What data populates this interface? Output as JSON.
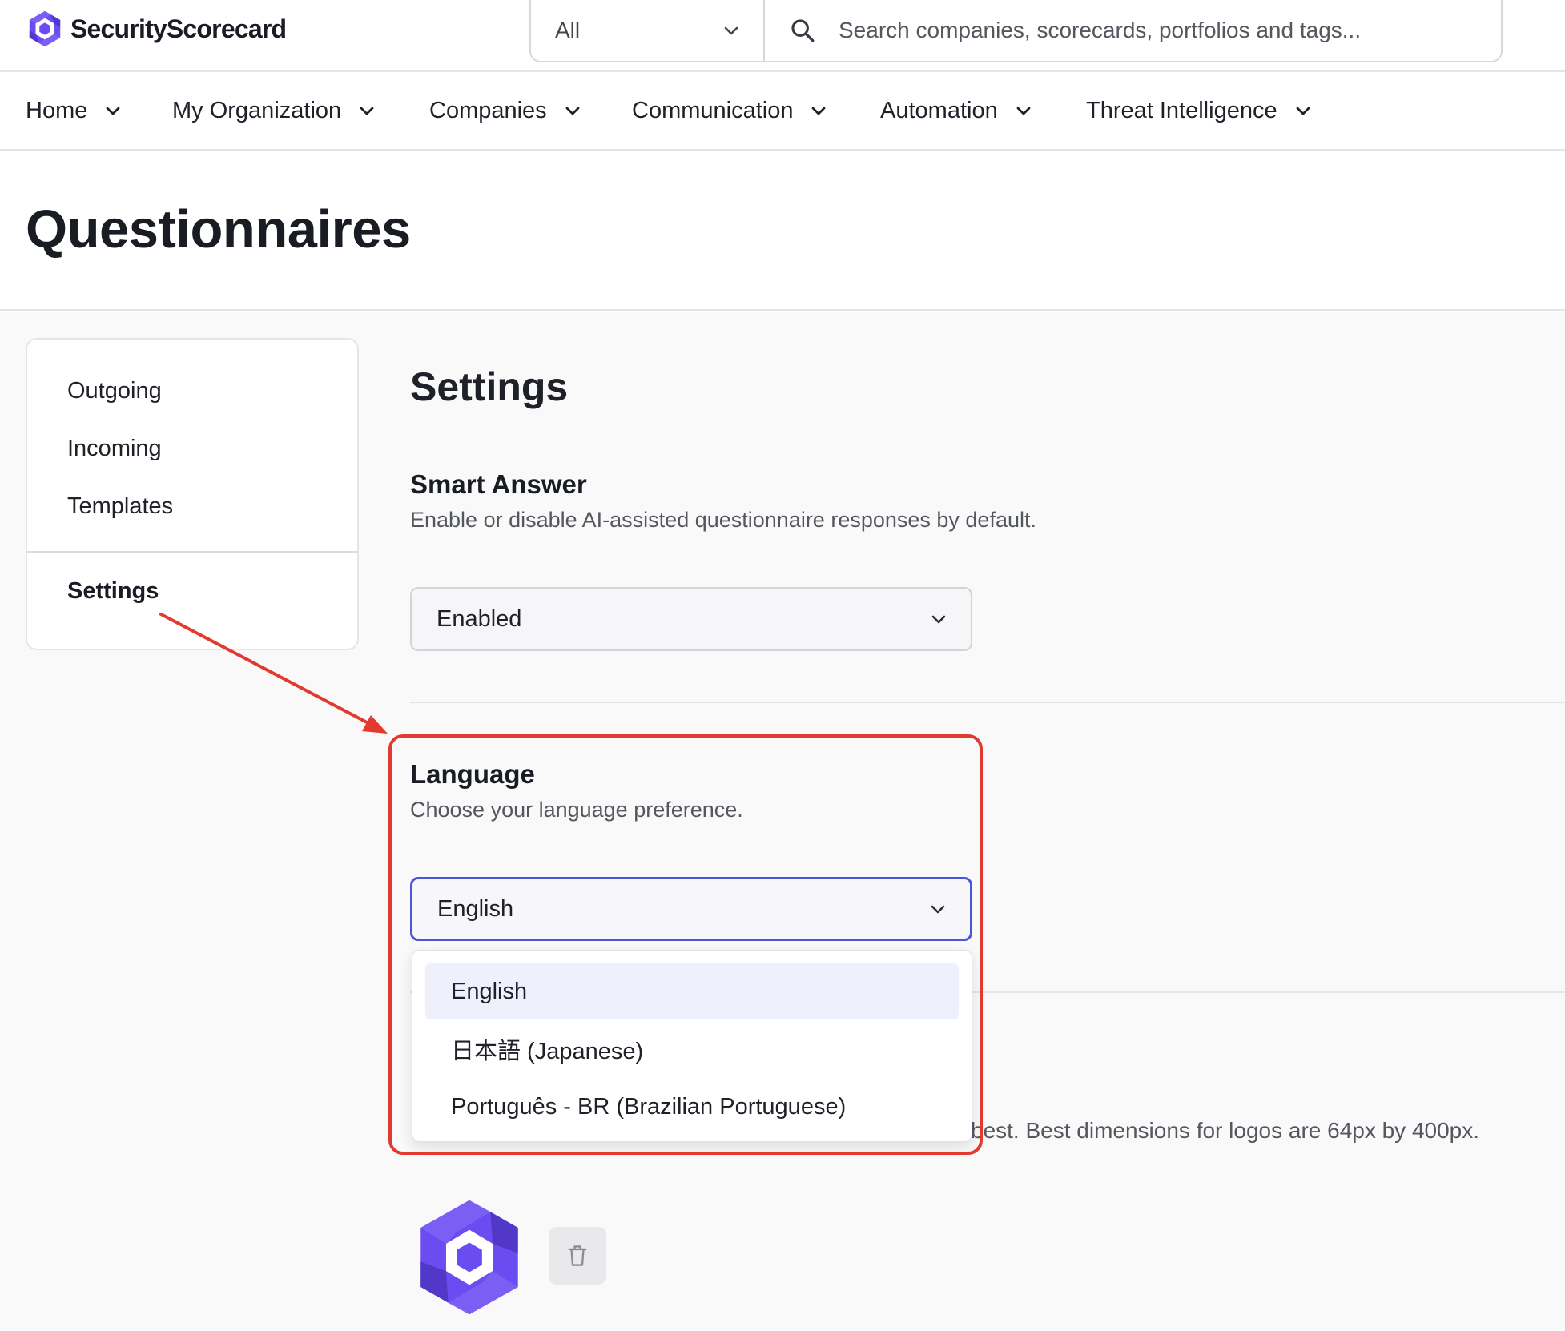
{
  "brand": {
    "name": "SecurityScorecard",
    "accent": "#6a4cf0"
  },
  "search": {
    "scope_value": "All",
    "placeholder": "Search companies, scorecards, portfolios and tags..."
  },
  "nav": {
    "items": [
      {
        "label": "Home"
      },
      {
        "label": "My Organization"
      },
      {
        "label": "Companies"
      },
      {
        "label": "Communication"
      },
      {
        "label": "Automation"
      },
      {
        "label": "Threat Intelligence"
      }
    ]
  },
  "page": {
    "title": "Questionnaires"
  },
  "sidebar": {
    "items": [
      {
        "label": "Outgoing"
      },
      {
        "label": "Incoming"
      },
      {
        "label": "Templates"
      },
      {
        "label": "Settings",
        "active": true
      }
    ]
  },
  "settings": {
    "title": "Settings",
    "smart_answer": {
      "title": "Smart Answer",
      "description": "Enable or disable AI-assisted questionnaire responses by default.",
      "value": "Enabled"
    },
    "language": {
      "title": "Language",
      "description": "Choose your language preference.",
      "value": "English",
      "options": [
        {
          "label": "English",
          "selected": true
        },
        {
          "label": "日本語 (Japanese)"
        },
        {
          "label": "Português - BR (Brazilian Portuguese)"
        }
      ]
    },
    "logo_hint_visible": "best. Best dimensions for logos are 64px by 400px."
  },
  "annotation": {
    "color": "#e23a2e"
  },
  "icons": {
    "search": "search-icon",
    "chevron": "chevron-down-icon",
    "trash": "trash-icon"
  }
}
